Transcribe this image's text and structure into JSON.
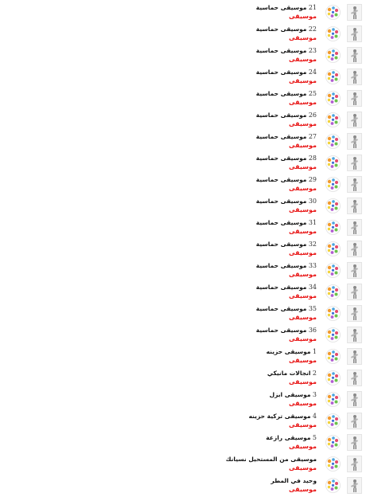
{
  "colors": {
    "accent_red": "#e81414",
    "text": "#111111",
    "thumb_bg": "#f4f4f4"
  },
  "icons": {
    "thumb_right": "guitar-player-icon",
    "thumb_mid": "colorful-circle-logo-icon"
  },
  "items": [
    {
      "num": "21",
      "title": "موسيقى حماسية",
      "sub": "موسيقى"
    },
    {
      "num": "22",
      "title": "موسيقى حماسية",
      "sub": "موسيقى"
    },
    {
      "num": "23",
      "title": "موسيقى حماسية",
      "sub": "موسيقى"
    },
    {
      "num": "24",
      "title": "موسيقى حماسية",
      "sub": "موسيقى"
    },
    {
      "num": "25",
      "title": "موسيقى حماسية",
      "sub": "موسيقى"
    },
    {
      "num": "26",
      "title": "موسيقى حماسية",
      "sub": "موسيقى"
    },
    {
      "num": "27",
      "title": "موسيقى حماسية",
      "sub": "موسيقى"
    },
    {
      "num": "28",
      "title": "موسيقى حماسية",
      "sub": "موسيقى"
    },
    {
      "num": "29",
      "title": "موسيقى حماسية",
      "sub": "موسيقى"
    },
    {
      "num": "30",
      "title": "موسيقى حماسية",
      "sub": "موسيقى"
    },
    {
      "num": "31",
      "title": "موسيقى حماسية",
      "sub": "موسيقى"
    },
    {
      "num": "32",
      "title": "موسيقى حماسية",
      "sub": "موسيقى"
    },
    {
      "num": "33",
      "title": "موسيقى حماسية",
      "sub": "موسيقى"
    },
    {
      "num": "34",
      "title": "موسيقى حماسية",
      "sub": "موسيقى"
    },
    {
      "num": "35",
      "title": "موسيقى حماسية",
      "sub": "موسيقى"
    },
    {
      "num": "36",
      "title": "موسيقى حماسية",
      "sub": "موسيقى"
    },
    {
      "num": "1",
      "title": "موسيقى حزينه",
      "sub": "موسيقى"
    },
    {
      "num": "2",
      "title": "انجالات مانيكي",
      "sub": "موسيقى"
    },
    {
      "num": "3",
      "title": "موسيقى ابزل",
      "sub": "موسيقى"
    },
    {
      "num": "4",
      "title": "موسيقى تركية حزينه",
      "sub": "موسيقى"
    },
    {
      "num": "5",
      "title": "موسيقى رازعة",
      "sub": "موسيقى"
    },
    {
      "num": "",
      "title": "موسيقى من المستحيل نسيانك",
      "sub": "موسيقى"
    },
    {
      "num": "",
      "title": "وحيد في المطر",
      "sub": "موسيقى"
    }
  ]
}
